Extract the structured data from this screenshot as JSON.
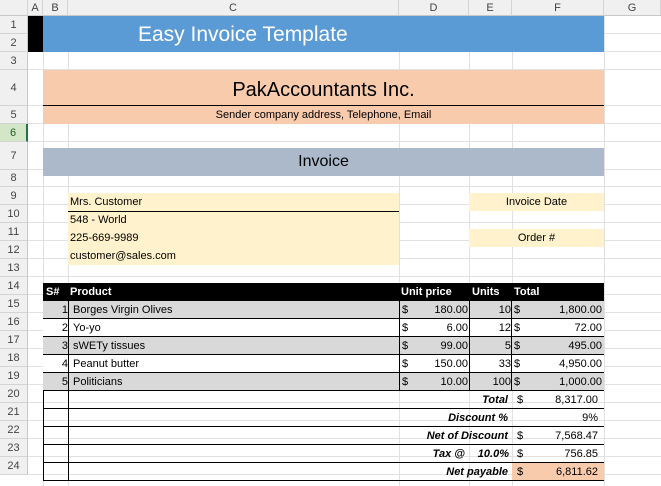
{
  "columns": [
    "A",
    "B",
    "C",
    "D",
    "E",
    "F",
    "G"
  ],
  "rows": [
    "1",
    "2",
    "3",
    "4",
    "5",
    "6",
    "7",
    "8",
    "9",
    "10",
    "11",
    "12",
    "13",
    "14",
    "15",
    "16",
    "17",
    "18",
    "19",
    "20",
    "21",
    "22",
    "23",
    "24"
  ],
  "header": {
    "title": "Easy Invoice Template"
  },
  "company": {
    "name": "PakAccountants Inc.",
    "details": "Sender company address, Telephone, Email"
  },
  "invoice_heading": "Invoice",
  "customer": {
    "name": "Mrs. Customer",
    "address": "548 - World",
    "phone": "225-669-9989",
    "email": "customer@sales.com"
  },
  "meta": {
    "invoice_date_label": "Invoice Date",
    "order_label": "Order #"
  },
  "table": {
    "headers": {
      "sn": "S#",
      "product": "Product",
      "unit_price": "Unit price",
      "units": "Units",
      "total": "Total"
    },
    "currency": "$",
    "rows": [
      {
        "sn": "1",
        "product": "Borges Virgin Olives",
        "price": "180.00",
        "units": "10",
        "total": "1,800.00"
      },
      {
        "sn": "2",
        "product": "Yo-yo",
        "price": "6.00",
        "units": "12",
        "total": "72.00"
      },
      {
        "sn": "3",
        "product": "sWETy tissues",
        "price": "99.00",
        "units": "5",
        "total": "495.00"
      },
      {
        "sn": "4",
        "product": "Peanut butter",
        "price": "150.00",
        "units": "33",
        "total": "4,950.00"
      },
      {
        "sn": "5",
        "product": "Politicians",
        "price": "10.00",
        "units": "100",
        "total": "1,000.00"
      }
    ]
  },
  "summary": {
    "total_label": "Total",
    "total_value": "8,317.00",
    "discount_label": "Discount %",
    "discount_value": "9%",
    "net_discount_label": "Net of Discount",
    "net_discount_value": "7,568.47",
    "tax_label": "Tax @",
    "tax_rate": "10.0%",
    "tax_value": "756.85",
    "net_payable_label": "Net payable",
    "net_payable_value": "6,811.62"
  },
  "colors": {
    "title_band": "#5b9bd5",
    "company_band": "#f8cbad",
    "invoice_band": "#acb9ca",
    "customer_band": "#fff2cc",
    "table_header": "#000000",
    "alt_row": "#d9d9d9"
  }
}
